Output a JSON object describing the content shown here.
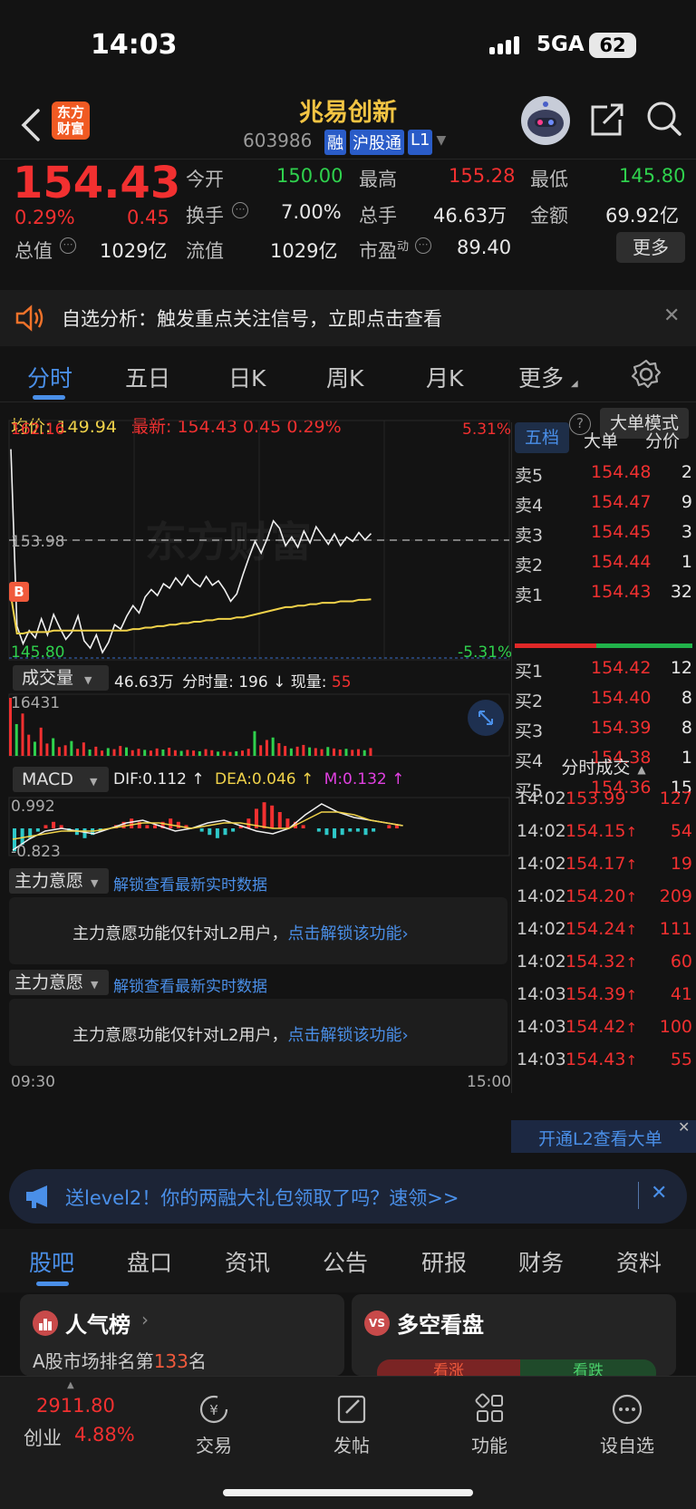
{
  "status_bar": {
    "time": "14:03",
    "network": "5GA",
    "battery": "62"
  },
  "header": {
    "logo_text_1": "东方",
    "logo_text_2": "财富",
    "stock_name": "兆易创新",
    "stock_code": "603986",
    "badges": [
      "融",
      "沪股通",
      "L1"
    ]
  },
  "quote": {
    "price": "154.43",
    "change_pct": "0.29%",
    "change": "0.45",
    "open_label": "今开",
    "open": "150.00",
    "high_label": "最高",
    "high": "155.28",
    "low_label": "最低",
    "low": "145.80",
    "turnover_label": "换手",
    "turnover": "7.00%",
    "volume_label": "总手",
    "volume": "46.63万",
    "amount_label": "金额",
    "amount": "69.92亿",
    "mktcap_label": "总值",
    "mktcap": "1029亿",
    "float_label": "流值",
    "float": "1029亿",
    "pe_label": "市盈",
    "pe_sup": "动",
    "pe": "89.40",
    "more_button": "更多"
  },
  "notice": {
    "text": "自选分析：触发重点关注信号，立即点击查看"
  },
  "chart_tabs": {
    "items": [
      "分时",
      "五日",
      "日K",
      "周K",
      "月K",
      "更多"
    ],
    "active": "分时"
  },
  "price_line": {
    "avg_label": "均价:",
    "avg": "149.94",
    "latest_label": "最新:",
    "latest": "154.43",
    "change": "0.45",
    "pct": "0.29%",
    "big_order_mode": "大单模式"
  },
  "chart_data": {
    "type": "line",
    "y_top": "162.16",
    "y_ref": "153.98",
    "y_bottom": "145.80",
    "pct_top": "5.31%",
    "pct_bottom": "-5.31%",
    "marker_label": "B",
    "watermark": "东方财富",
    "x_start": "09:30",
    "x_end": "15:00",
    "ylim": [
      145.8,
      162.16
    ],
    "price_series": [
      160.2,
      148.1,
      146.9,
      147.8,
      147.3,
      148.6,
      147.5,
      148.9,
      148.0,
      147.2,
      147.7,
      148.8,
      147.1,
      146.6,
      147.5,
      146.3,
      147.0,
      148.2,
      147.9,
      148.8,
      149.5,
      149.0,
      150.1,
      150.6,
      150.2,
      151.0,
      150.7,
      151.4,
      150.9,
      151.6,
      151.1,
      150.8,
      151.5,
      150.9,
      151.2,
      150.6,
      149.8,
      150.3,
      151.6,
      152.8,
      153.9,
      153.1,
      154.1,
      155.3,
      154.8,
      153.6,
      154.2,
      153.5,
      154.6,
      153.8,
      154.9,
      154.3,
      153.7,
      154.4,
      153.6,
      154.2,
      153.9,
      154.5,
      154.0,
      154.43
    ],
    "avg_series": [
      150.2,
      147.6,
      147.6,
      147.7,
      147.7,
      147.7,
      147.7,
      147.8,
      147.8,
      147.8,
      147.8,
      147.8,
      147.8,
      147.8,
      147.8,
      147.8,
      147.8,
      147.8,
      147.8,
      147.8,
      147.9,
      147.9,
      148.0,
      148.0,
      148.1,
      148.1,
      148.2,
      148.2,
      148.3,
      148.3,
      148.4,
      148.4,
      148.5,
      148.5,
      148.6,
      148.6,
      148.6,
      148.7,
      148.7,
      148.8,
      148.9,
      149.0,
      149.1,
      149.2,
      149.3,
      149.4,
      149.4,
      149.5,
      149.5,
      149.6,
      149.6,
      149.7,
      149.7,
      149.7,
      149.8,
      149.8,
      149.8,
      149.9,
      149.9,
      149.94
    ],
    "volume_max": "16431",
    "volume_series": [
      16431,
      9000,
      12000,
      6000,
      4000,
      8000,
      3500,
      5000,
      2500,
      3000,
      4200,
      2000,
      3800,
      1800,
      2600,
      1500,
      2200,
      1900,
      2800,
      2400,
      1600,
      2000,
      1700,
      1500,
      2100,
      1800,
      2300,
      1600,
      1400,
      1700,
      1500,
      1300,
      1900,
      1600,
      1200,
      1400,
      1100,
      1300,
      1500,
      2000,
      7000,
      3000,
      4500,
      5200,
      3600,
      2800,
      2100,
      2600,
      3100,
      2400,
      2200,
      1900,
      2500,
      2100,
      1800,
      2000,
      1700,
      1900,
      1600,
      2200
    ],
    "macd": {
      "top": "0.992",
      "bottom": "-0.823",
      "dif": "DIF:0.112",
      "dea": "DEA:0.046",
      "m": "M:0.132"
    }
  },
  "volume_panel": {
    "label": "成交量",
    "total": "46.63万",
    "period_label": "分时量:",
    "period": "196",
    "now_label": "现量:",
    "now": "55"
  },
  "macd_panel": {
    "label": "MACD"
  },
  "main_intent": {
    "label": "主力意愿",
    "unlock_link": "解锁查看最新实时数据",
    "message": "主力意愿功能仅针对L2用户，",
    "message_link": "点击解锁该功能"
  },
  "order_book": {
    "tabs": [
      "五档",
      "大单",
      "分价"
    ],
    "asks": [
      {
        "label": "卖5",
        "price": "154.48",
        "qty": "2"
      },
      {
        "label": "卖4",
        "price": "154.47",
        "qty": "9"
      },
      {
        "label": "卖3",
        "price": "154.45",
        "qty": "3"
      },
      {
        "label": "卖2",
        "price": "154.44",
        "qty": "1"
      },
      {
        "label": "卖1",
        "price": "154.43",
        "qty": "32"
      }
    ],
    "bids": [
      {
        "label": "买1",
        "price": "154.42",
        "qty": "12"
      },
      {
        "label": "买2",
        "price": "154.40",
        "qty": "8"
      },
      {
        "label": "买3",
        "price": "154.39",
        "qty": "8"
      },
      {
        "label": "买4",
        "price": "154.38",
        "qty": "1"
      },
      {
        "label": "买5",
        "price": "154.36",
        "qty": "15"
      }
    ]
  },
  "trades": {
    "title": "分时成交",
    "rows": [
      {
        "time": "14:02",
        "price": "153.99",
        "qty": "127",
        "arrow": "",
        "color": "red"
      },
      {
        "time": "14:02",
        "price": "154.15",
        "qty": "54",
        "arrow": "↑",
        "color": "red"
      },
      {
        "time": "14:02",
        "price": "154.17",
        "qty": "19",
        "arrow": "↑",
        "color": "red"
      },
      {
        "time": "14:02",
        "price": "154.20",
        "qty": "209",
        "arrow": "↑",
        "color": "red"
      },
      {
        "time": "14:02",
        "price": "154.24",
        "qty": "111",
        "arrow": "↑",
        "color": "red"
      },
      {
        "time": "14:02",
        "price": "154.32",
        "qty": "60",
        "arrow": "↑",
        "color": "red"
      },
      {
        "time": "14:03",
        "price": "154.39",
        "qty": "41",
        "arrow": "↑",
        "color": "red"
      },
      {
        "time": "14:03",
        "price": "154.42",
        "qty": "100",
        "arrow": "↑",
        "color": "red"
      },
      {
        "time": "14:03",
        "price": "154.43",
        "qty": "55",
        "arrow": "↑",
        "color": "red"
      }
    ],
    "l2_banner": "开通L2查看大单"
  },
  "promo": {
    "text": "送level2！你的两融大礼包领取了吗？速领>>"
  },
  "bottom_tabs": {
    "items": [
      "股吧",
      "盘口",
      "资讯",
      "公告",
      "研报",
      "财务",
      "资料"
    ],
    "active": "股吧"
  },
  "cards": {
    "popularity": {
      "title": "人气榜",
      "desc_prefix": "A股市场排名第",
      "rank": "133",
      "desc_suffix": "名"
    },
    "bullbear": {
      "title": "多空看盘",
      "bull": "看涨",
      "bear": "看跌",
      "badge": "VS"
    }
  },
  "nav": {
    "index_value": "2911.80",
    "index_name": "创业",
    "index_pct": "4.88%",
    "items": [
      "交易",
      "发帖",
      "功能",
      "设自选"
    ]
  }
}
